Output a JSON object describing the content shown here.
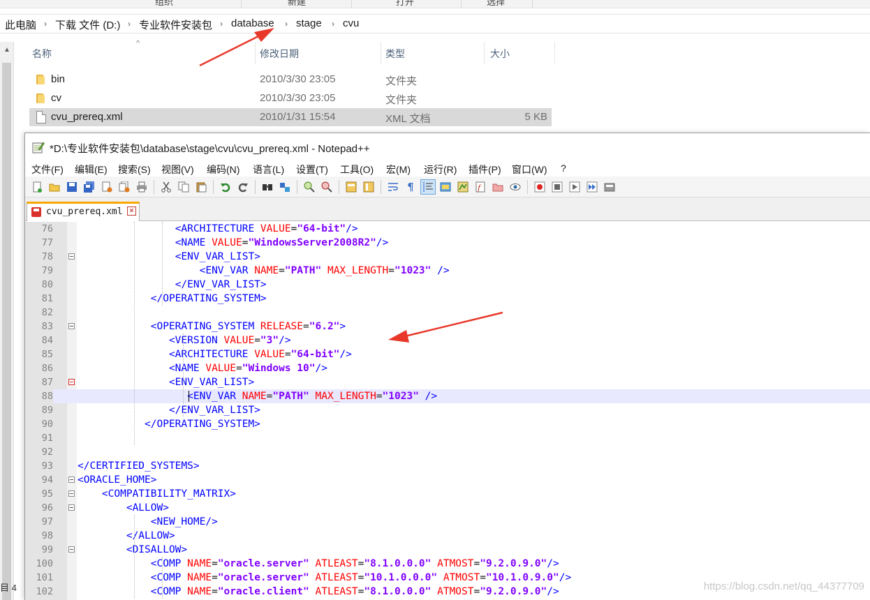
{
  "explorer": {
    "ribbon": [
      "组织",
      "新建",
      "打开",
      "选择"
    ],
    "breadcrumb": [
      "此电脑",
      "下载 文件 (D:)",
      "专业软件安装包",
      "database",
      "stage",
      "cvu"
    ],
    "columns": [
      "名称",
      "修改日期",
      "类型",
      "大小"
    ],
    "files": [
      {
        "name": "bin",
        "date": "2010/3/30 23:05",
        "type": "文件夹",
        "size": "",
        "icon": "folder-icon"
      },
      {
        "name": "cv",
        "date": "2010/3/30 23:05",
        "type": "文件夹",
        "size": "",
        "icon": "folder-icon"
      },
      {
        "name": "cvu_prereq.xml",
        "date": "2010/1/31 15:54",
        "type": "XML 文档",
        "size": "5 KB",
        "icon": "file-icon"
      }
    ],
    "status": "目 4"
  },
  "npp": {
    "title": "*D:\\专业软件安装包\\database\\stage\\cvu\\cvu_prereq.xml - Notepad++",
    "menu": [
      "文件(F)",
      "编辑(E)",
      "搜索(S)",
      "视图(V)",
      "编码(N)",
      "语言(L)",
      "设置(T)",
      "工具(O)",
      "宏(M)",
      "运行(R)",
      "插件(P)",
      "窗口(W)",
      "?"
    ],
    "tab": {
      "label": "cvu_prereq.xml",
      "close": "×"
    },
    "lines": [
      {
        "num": "76",
        "text": "                <ARCHITECTURE VALUE=\"64-bit\"/>"
      },
      {
        "num": "77",
        "text": "                <NAME VALUE=\"WindowsServer2008R2\"/>"
      },
      {
        "num": "78",
        "text": "                <ENV_VAR_LIST>"
      },
      {
        "num": "79",
        "text": "                    <ENV_VAR NAME=\"PATH\" MAX_LENGTH=\"1023\" />"
      },
      {
        "num": "80",
        "text": "                </ENV_VAR_LIST>"
      },
      {
        "num": "81",
        "text": "            </OPERATING_SYSTEM>"
      },
      {
        "num": "82",
        "text": ""
      },
      {
        "num": "83",
        "text": "            <OPERATING_SYSTEM RELEASE=\"6.2\">"
      },
      {
        "num": "84",
        "text": "               <VERSION VALUE=\"3\"/>"
      },
      {
        "num": "85",
        "text": "               <ARCHITECTURE VALUE=\"64-bit\"/>"
      },
      {
        "num": "86",
        "text": "               <NAME VALUE=\"Windows 10\"/>"
      },
      {
        "num": "87",
        "text": "               <ENV_VAR_LIST>"
      },
      {
        "num": "88",
        "text": "                  <ENV_VAR NAME=\"PATH\" MAX_LENGTH=\"1023\" />"
      },
      {
        "num": "89",
        "text": "               </ENV_VAR_LIST>"
      },
      {
        "num": "90",
        "text": "           </OPERATING_SYSTEM>"
      },
      {
        "num": "91",
        "text": ""
      },
      {
        "num": "92",
        "text": ""
      },
      {
        "num": "93",
        "text": "</CERTIFIED_SYSTEMS>"
      },
      {
        "num": "94",
        "text": "<ORACLE_HOME>"
      },
      {
        "num": "95",
        "text": "    <COMPATIBILITY_MATRIX>"
      },
      {
        "num": "96",
        "text": "        <ALLOW>"
      },
      {
        "num": "97",
        "text": "            <NEW_HOME/>"
      },
      {
        "num": "98",
        "text": "        </ALLOW>"
      },
      {
        "num": "99",
        "text": "        <DISALLOW>"
      },
      {
        "num": "100",
        "text": "            <COMP NAME=\"oracle.server\" ATLEAST=\"8.1.0.0.0\" ATMOST=\"9.2.0.9.0\"/>"
      },
      {
        "num": "101",
        "text": "            <COMP NAME=\"oracle.server\" ATLEAST=\"10.1.0.0.0\" ATMOST=\"10.1.0.9.0\"/>"
      },
      {
        "num": "102",
        "text": "            <COMP NAME=\"oracle.client\" ATLEAST=\"8.1.0.0.0\" ATMOST=\"9.2.0.9.0\"/>"
      }
    ]
  },
  "watermark": "https://blog.csdn.net/qq_44377709",
  "colors": {
    "tag": "#0000ff",
    "attr": "#ff0000",
    "val": "#8000ff",
    "current_line": "#e8e8ff",
    "arrow": "#e8382a"
  }
}
